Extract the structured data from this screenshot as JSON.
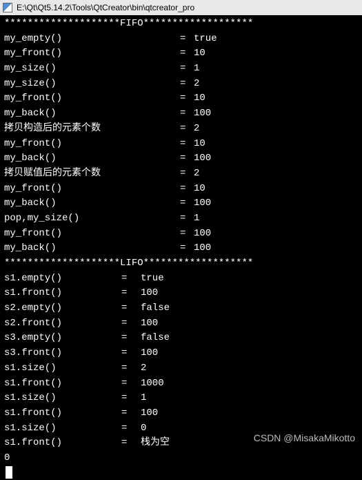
{
  "window": {
    "title": "E:\\Qt\\Qt5.14.2\\Tools\\QtCreator\\bin\\qtcreator_pro"
  },
  "fifo": {
    "header": "********************FIFO*******************",
    "rows": [
      {
        "label": "my_empty()",
        "eq": "=",
        "val": "true"
      },
      {
        "label": "my_front()",
        "eq": "=",
        "val": "10"
      },
      {
        "label": "my_size()",
        "eq": "=",
        "val": "1"
      },
      {
        "label": "my_size()",
        "eq": "=",
        "val": "2"
      },
      {
        "label": "my_front()",
        "eq": "=",
        "val": "10"
      },
      {
        "label": "my_back()",
        "eq": "=",
        "val": "100"
      },
      {
        "label": "拷贝构造后的元素个数",
        "eq": "=",
        "val": "2"
      },
      {
        "label": "my_front()",
        "eq": "=",
        "val": "10"
      },
      {
        "label": "my_back()",
        "eq": "=",
        "val": "100"
      },
      {
        "label": "拷贝赋值后的元素个数",
        "eq": "=",
        "val": "2"
      },
      {
        "label": "my_front()",
        "eq": "=",
        "val": "10"
      },
      {
        "label": "my_back()",
        "eq": "=",
        "val": "100"
      },
      {
        "label": "pop,my_size()",
        "eq": "=",
        "val": "1"
      },
      {
        "label": "my_front()",
        "eq": "=",
        "val": "100"
      },
      {
        "label": "my_back()",
        "eq": "=",
        "val": "100"
      }
    ]
  },
  "lifo": {
    "header": "********************LIFO*******************",
    "rows": [
      {
        "label": "s1.empty()",
        "eq": "=",
        "val": "true"
      },
      {
        "label": "s1.front()",
        "eq": "=",
        "val": "100"
      },
      {
        "label": "s2.empty()",
        "eq": "=",
        "val": "false"
      },
      {
        "label": "s2.front()",
        "eq": "=",
        "val": "100"
      },
      {
        "label": "s3.empty()",
        "eq": "=",
        "val": "false"
      },
      {
        "label": "s3.front()",
        "eq": "=",
        "val": "100"
      },
      {
        "label": "s1.size()",
        "eq": "=",
        "val": "2"
      },
      {
        "label": "s1.front()",
        "eq": "=",
        "val": "1000"
      },
      {
        "label": "s1.size()",
        "eq": "=",
        "val": "1"
      },
      {
        "label": "s1.front()",
        "eq": "=",
        "val": "100"
      },
      {
        "label": "s1.size()",
        "eq": "=",
        "val": "0"
      },
      {
        "label": "s1.front()",
        "eq": "=",
        "val": "栈为空"
      }
    ]
  },
  "trailing_zero": "0",
  "watermark": "CSDN @MisakaMikotto"
}
